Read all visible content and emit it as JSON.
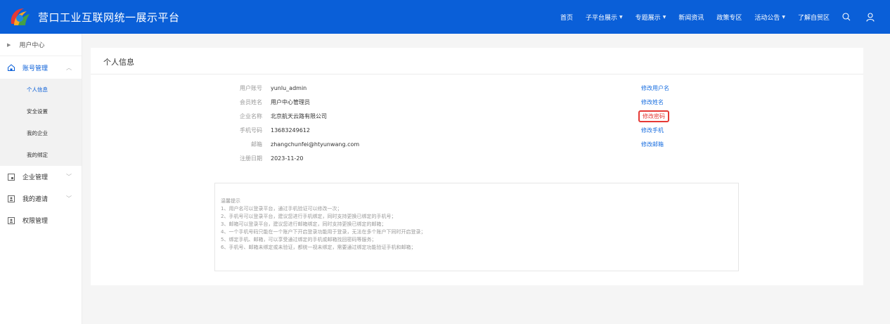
{
  "header": {
    "brand": "营口工业互联网统一展示平台",
    "nav": [
      {
        "label": "首页",
        "dropdown": false
      },
      {
        "label": "子平台展示",
        "dropdown": true
      },
      {
        "label": "专题展示",
        "dropdown": true
      },
      {
        "label": "新闻资讯",
        "dropdown": false
      },
      {
        "label": "政策专区",
        "dropdown": false
      },
      {
        "label": "活动公告",
        "dropdown": true
      },
      {
        "label": "了解自贸区",
        "dropdown": false
      }
    ],
    "icons": [
      "search-icon",
      "user-icon"
    ],
    "color": "#0a5fd8"
  },
  "sidebar": {
    "top": "用户中心",
    "account_group": "账号管理",
    "account_items": [
      "个人信息",
      "安全设置",
      "我的企业",
      "我的绑定"
    ],
    "active_item": "个人信息",
    "lower_groups": [
      "企业管理",
      "我的邀请",
      "权限管理"
    ]
  },
  "main": {
    "title": "个人信息",
    "rows": [
      {
        "label": "用户账号",
        "value": "yunlu_admin",
        "action": "修改用户名"
      },
      {
        "label": "会员姓名",
        "value": "用户中心管理员",
        "action": "修改姓名"
      },
      {
        "label": "企业名称",
        "value": "北京航天云路有限公司",
        "action": "修改密码"
      },
      {
        "label": "手机号码",
        "value": "13683249612",
        "action": "修改手机"
      },
      {
        "label": "邮箱",
        "value": "zhangchunfei@htyunwang.com",
        "action": "修改邮箱"
      },
      {
        "label": "注册日期",
        "value": "2023-11-20",
        "action": ""
      }
    ],
    "tips": {
      "title": "温馨提示",
      "lines": [
        "1、用户名可以登录平台，通过手机验证可以修改一次；",
        "2、手机号可以登录平台，建议您进行手机绑定，同时支持更换已绑定的手机号；",
        "3、邮箱可以登录平台，建议您进行邮箱绑定，同时支持更换已绑定的邮箱；",
        "4、一个手机号码只能在一个账户下开启登录功能用于登录，无法在多个账户下同时开启登录；",
        "5、绑定手机、邮箱，可以享受通过绑定的手机或邮箱找回密码等服务；",
        "6、手机号、邮箱未绑定或未验证，都统一视未绑定，需要通过绑定功能验证手机和邮箱；"
      ]
    },
    "highlight_color": "#e53935",
    "link_color": "#1a6fe0"
  }
}
